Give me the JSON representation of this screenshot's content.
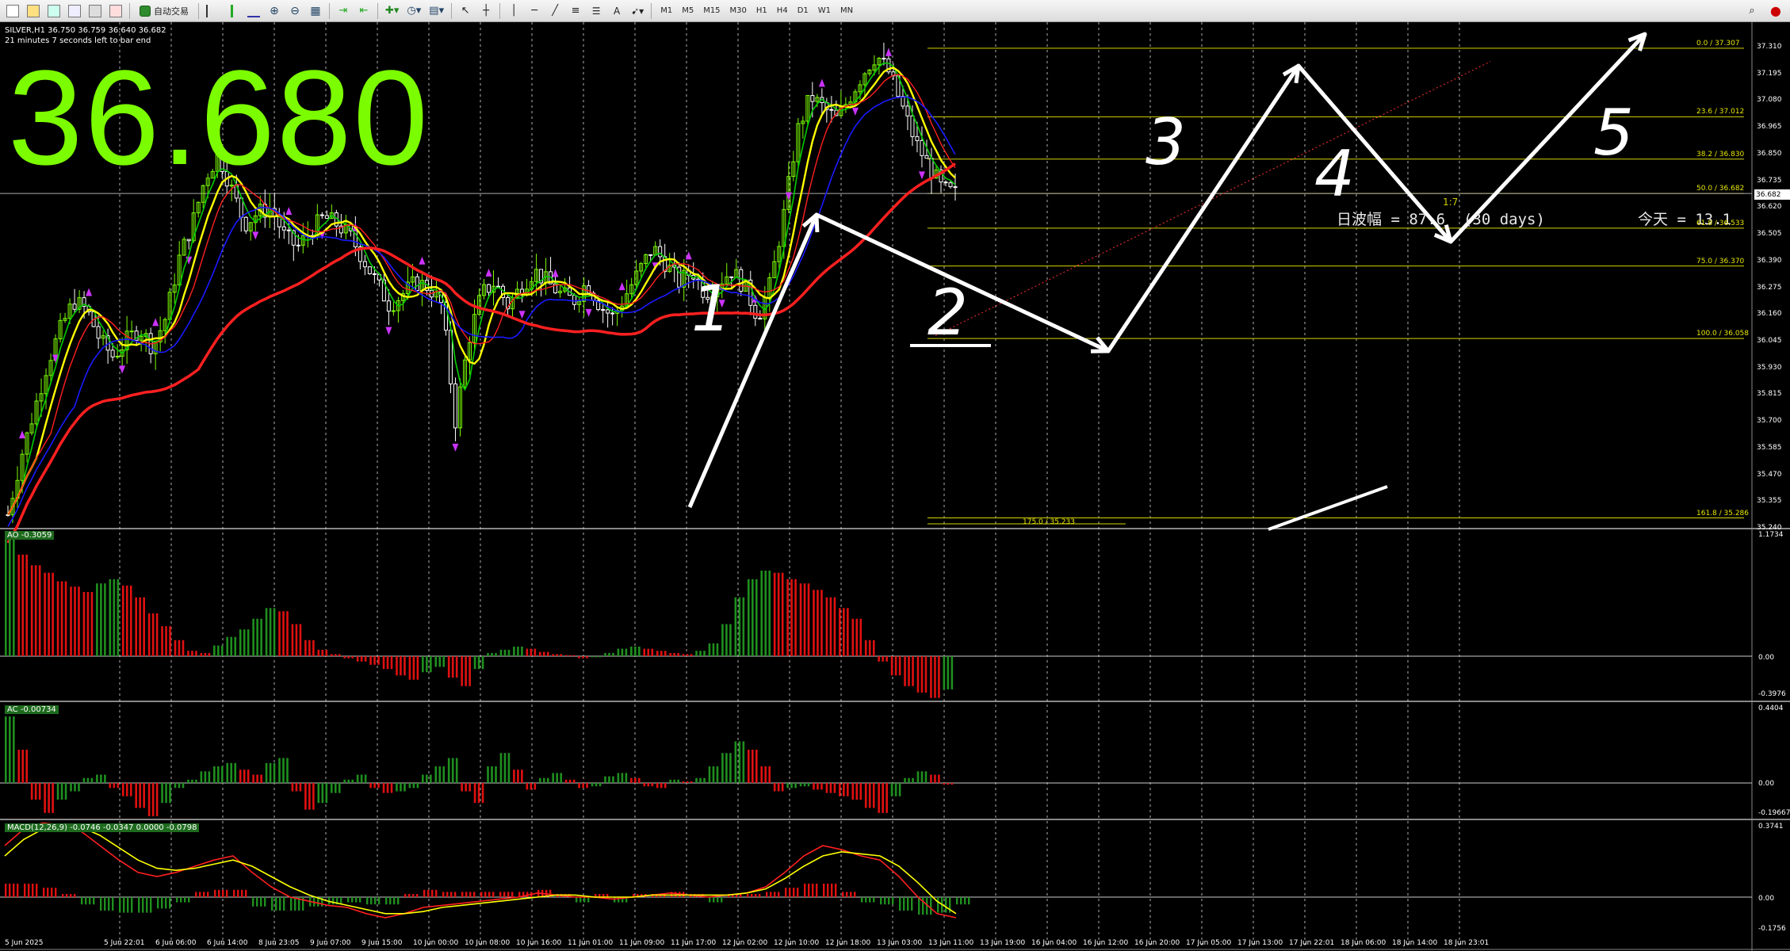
{
  "toolbar": {
    "auto_trade_label": "自动交易",
    "timeframes": [
      "M1",
      "M5",
      "M15",
      "M30",
      "H1",
      "H4",
      "D1",
      "W1",
      "MN"
    ],
    "icons": [
      "new-chart-icon",
      "profiles-icon",
      "market-watch-icon",
      "navigator-icon",
      "terminal-icon",
      "strategy-tester-icon",
      "bar-chart-icon",
      "candles-icon",
      "line-chart-icon",
      "zoom-in-icon",
      "zoom-out-icon",
      "tile-icon",
      "autoscroll-icon",
      "chart-shift-icon",
      "indicators-icon",
      "periods-icon",
      "templates-icon",
      "cursor-icon",
      "crosshair-icon",
      "vertical-line-icon",
      "horizontal-line-icon",
      "trendline-icon",
      "channel-icon",
      "fibonacci-icon",
      "text-icon",
      "arrows-icon",
      "search-icon",
      "alert-icon"
    ]
  },
  "main_pane": {
    "symbol_line": "SILVER,H1  36.750 36.759 36.640 36.682",
    "countdown": "21 minutes 7 seconds left to bar end",
    "big_price": "36.680",
    "current_price_tag": "36.682",
    "daily_range_text": "日波幅 = 87.6  (30 days)",
    "today_text": "今天 = 13.1",
    "ratio_text": "1:7",
    "wave_labels": [
      "1",
      "2",
      "3",
      "4",
      "5"
    ],
    "fib_levels": [
      {
        "label": "0.0 / 37.307",
        "price": 37.307
      },
      {
        "label": "23.6 / 37.012",
        "price": 37.012
      },
      {
        "label": "38.2 / 36.830",
        "price": 36.83
      },
      {
        "label": "50.0 / 36.682",
        "price": 36.682
      },
      {
        "label": "61.8 / 36.533",
        "price": 36.533
      },
      {
        "label": "75.0 / 36.370",
        "price": 36.37
      },
      {
        "label": "100.0 / 36.058",
        "price": 36.058
      },
      {
        "label": "161.8 / 35.286",
        "price": 35.286
      }
    ],
    "fib_ext_label": "175.0 / 35.233",
    "price_axis": [
      "37.310",
      "37.195",
      "37.080",
      "36.965",
      "36.850",
      "36.735",
      "36.620",
      "36.505",
      "36.390",
      "36.275",
      "36.160",
      "36.045",
      "35.930",
      "35.815",
      "35.700",
      "35.585",
      "35.470",
      "35.355",
      "35.240"
    ]
  },
  "ao_pane": {
    "label": "AO -0.3059",
    "axis": [
      "1.1734",
      "0.00",
      "-0.3976"
    ]
  },
  "ac_pane": {
    "label": "AC -0.00734",
    "axis": [
      "0.4404",
      "0.00",
      "-0.19667"
    ]
  },
  "macd_pane": {
    "label": "MACD(12,26,9) -0.0746 -0.0347 0.0000 -0.0798",
    "axis": [
      "0.3741",
      "0.00",
      "-0.1756"
    ]
  },
  "time_axis": [
    "5 Jun 2025",
    "5 Jun 22:01",
    "6 Jun 06:00",
    "6 Jun 14:00",
    "8 Jun 23:05",
    "9 Jun 07:00",
    "9 Jun 15:00",
    "10 Jun 00:00",
    "10 Jun 08:00",
    "10 Jun 16:00",
    "11 Jun 01:00",
    "11 Jun 09:00",
    "11 Jun 17:00",
    "12 Jun 02:00",
    "12 Jun 10:00",
    "12 Jun 18:00",
    "13 Jun 03:00",
    "13 Jun 11:00",
    "13 Jun 19:00",
    "16 Jun 04:00",
    "16 Jun 12:00",
    "16 Jun 20:00",
    "17 Jun 05:00",
    "17 Jun 13:00",
    "17 Jun 22:01",
    "18 Jun 06:00",
    "18 Jun 14:00",
    "18 Jun 23:01"
  ],
  "colors": {
    "bull": "#7cfc00",
    "bear": "#ffffff",
    "ma_red": "#ff2020",
    "ma_yellow": "#ffff00",
    "ma_green": "#00cc00",
    "ma_blue": "#1a1aff",
    "fib": "#d4d400",
    "hist_up": "#1f8f1f",
    "hist_down": "#e01010"
  },
  "chart_data": {
    "type": "candlestick",
    "symbol": "SILVER",
    "timeframe": "H1",
    "ylim": [
      35.24,
      37.31
    ],
    "ohlc_last": {
      "open": 36.75,
      "high": 36.759,
      "low": 36.64,
      "close": 36.682
    },
    "close_path": [
      35.3,
      35.55,
      35.75,
      35.95,
      36.1,
      36.22,
      36.18,
      36.05,
      35.98,
      36.05,
      36.1,
      36.02,
      36.15,
      36.4,
      36.55,
      36.75,
      36.85,
      36.7,
      36.55,
      36.6,
      36.62,
      36.5,
      36.45,
      36.52,
      36.58,
      36.55,
      36.5,
      36.4,
      36.3,
      36.2,
      36.25,
      36.3,
      36.28,
      36.2,
      35.7,
      36.05,
      36.25,
      36.3,
      36.2,
      36.28,
      36.35,
      36.3,
      36.25,
      36.22,
      36.3,
      36.2,
      36.15,
      36.25,
      36.35,
      36.45,
      36.38,
      36.3,
      36.35,
      36.25,
      36.3,
      36.35,
      36.28,
      36.15,
      36.3,
      36.6,
      36.95,
      37.1,
      37.05,
      37.0,
      37.1,
      37.2,
      37.28,
      37.2,
      37.05,
      36.9,
      36.8,
      36.7,
      36.68
    ],
    "ao_values": [
      1.1,
      0.95,
      0.85,
      0.78,
      0.7,
      0.65,
      0.6,
      0.68,
      0.72,
      0.66,
      0.55,
      0.4,
      0.28,
      0.15,
      0.05,
      0.03,
      0.1,
      0.18,
      0.25,
      0.35,
      0.45,
      0.42,
      0.3,
      0.15,
      0.06,
      0.02,
      -0.02,
      -0.05,
      -0.08,
      -0.12,
      -0.18,
      -0.22,
      -0.15,
      -0.1,
      -0.2,
      -0.28,
      -0.12,
      0.03,
      0.06,
      0.09,
      0.07,
      0.04,
      0.02,
      0.01,
      -0.02,
      -0.01,
      0.03,
      0.07,
      0.09,
      0.07,
      0.05,
      0.03,
      0.02,
      0.05,
      0.12,
      0.3,
      0.55,
      0.72,
      0.8,
      0.78,
      0.72,
      0.68,
      0.62,
      0.55,
      0.45,
      0.35,
      0.15,
      -0.05,
      -0.18,
      -0.28,
      -0.34,
      -0.39,
      -0.31
    ],
    "ac_values": [
      0.4,
      0.2,
      -0.1,
      -0.18,
      -0.1,
      -0.05,
      0.03,
      0.05,
      -0.03,
      -0.08,
      -0.15,
      -0.2,
      -0.12,
      -0.03,
      0.02,
      0.07,
      0.1,
      0.12,
      0.08,
      0.05,
      0.12,
      0.15,
      -0.05,
      -0.16,
      -0.12,
      -0.06,
      0.02,
      0.05,
      -0.03,
      -0.06,
      -0.05,
      -0.03,
      0.05,
      0.1,
      0.15,
      -0.05,
      -0.12,
      0.1,
      0.18,
      0.08,
      -0.04,
      0.03,
      0.06,
      0.02,
      -0.03,
      -0.02,
      0.04,
      0.06,
      0.03,
      -0.02,
      -0.03,
      0.02,
      0.01,
      0.03,
      0.1,
      0.18,
      0.25,
      0.2,
      0.1,
      -0.05,
      -0.03,
      -0.02,
      -0.04,
      -0.06,
      -0.08,
      -0.1,
      -0.15,
      -0.18,
      -0.08,
      0.03,
      0.07,
      0.05,
      -0.01
    ],
    "macd_line": [
      0.25,
      0.33,
      0.36,
      0.35,
      0.32,
      0.25,
      0.18,
      0.12,
      0.1,
      0.12,
      0.15,
      0.18,
      0.2,
      0.12,
      0.05,
      0.0,
      -0.02,
      -0.04,
      -0.05,
      -0.08,
      -0.1,
      -0.08,
      -0.05,
      -0.04,
      -0.03,
      -0.02,
      -0.01,
      0.0,
      0.02,
      0.01,
      0.0,
      0.0,
      -0.01,
      0.0,
      0.01,
      0.02,
      0.01,
      0.0,
      0.01,
      0.02,
      0.05,
      0.12,
      0.2,
      0.25,
      0.23,
      0.2,
      0.18,
      0.1,
      0.0,
      -0.08,
      -0.1
    ],
    "macd_signal": [
      0.2,
      0.28,
      0.33,
      0.35,
      0.34,
      0.3,
      0.24,
      0.18,
      0.14,
      0.13,
      0.14,
      0.16,
      0.18,
      0.15,
      0.1,
      0.05,
      0.01,
      -0.02,
      -0.04,
      -0.06,
      -0.08,
      -0.08,
      -0.07,
      -0.05,
      -0.04,
      -0.03,
      -0.02,
      -0.01,
      0.0,
      0.01,
      0.01,
      0.0,
      0.0,
      0.0,
      0.01,
      0.01,
      0.01,
      0.01,
      0.01,
      0.02,
      0.04,
      0.09,
      0.15,
      0.2,
      0.22,
      0.21,
      0.2,
      0.15,
      0.07,
      -0.02,
      -0.08
    ]
  }
}
